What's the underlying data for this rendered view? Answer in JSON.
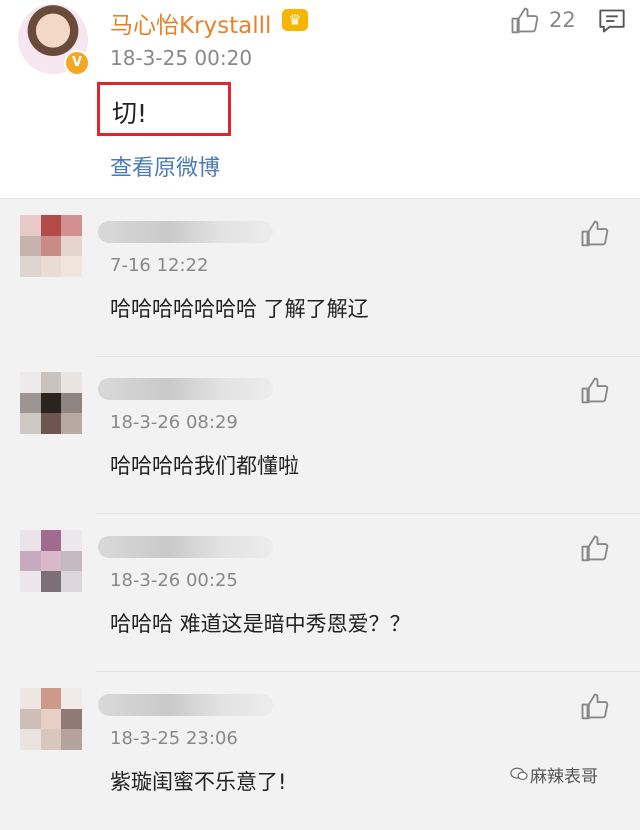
{
  "post": {
    "username": "马心怡Krystalll",
    "verified_badge": "V",
    "crown_icon": "crown-icon",
    "time": "18-3-25 00:20",
    "like_count": "22",
    "content": "切!",
    "view_original": "查看原微博",
    "colors": {
      "username": "#e8822a",
      "link": "#4b7bb5",
      "highlight_box": "#e0262b"
    }
  },
  "comments": [
    {
      "time": "7-16 12:22",
      "text": "哈哈哈哈哈哈哈 了解了解辽",
      "avatar_colors": [
        "#e7c9c9",
        "#b34a4a",
        "#d49090",
        "#c7b2ae",
        "#c88b86",
        "#e6d5cf",
        "#ded4d2",
        "#e8dcd5",
        "#efe5dc"
      ]
    },
    {
      "time": "18-3-26 08:29",
      "text": "哈哈哈哈我们都懂啦",
      "avatar_colors": [
        "#eceaea",
        "#c8c2c0",
        "#e8e4e2",
        "#9c9594",
        "#2a2320",
        "#8f8480",
        "#cfc9c6",
        "#6e5650",
        "#b9a9a3"
      ]
    },
    {
      "time": "18-3-26 00:25",
      "text": "哈哈哈  难道这是暗中秀恩爱？？",
      "avatar_colors": [
        "#e9e4e8",
        "#a06b8f",
        "#ece7eb",
        "#c7a9bd",
        "#d8b8c9",
        "#c3b9bf",
        "#ebe6e9",
        "#7c6f76",
        "#dcd5d9"
      ]
    },
    {
      "time": "18-3-25 23:06",
      "text": "紫璇闺蜜不乐意了!",
      "avatar_colors": [
        "#ede6e4",
        "#cc9a8a",
        "#f0ebea",
        "#cdbfb8",
        "#e8d0c6",
        "#8f7b73",
        "#ebe3df",
        "#d9c7bd",
        "#b3a39c"
      ]
    }
  ],
  "watermark": "麻辣表哥"
}
